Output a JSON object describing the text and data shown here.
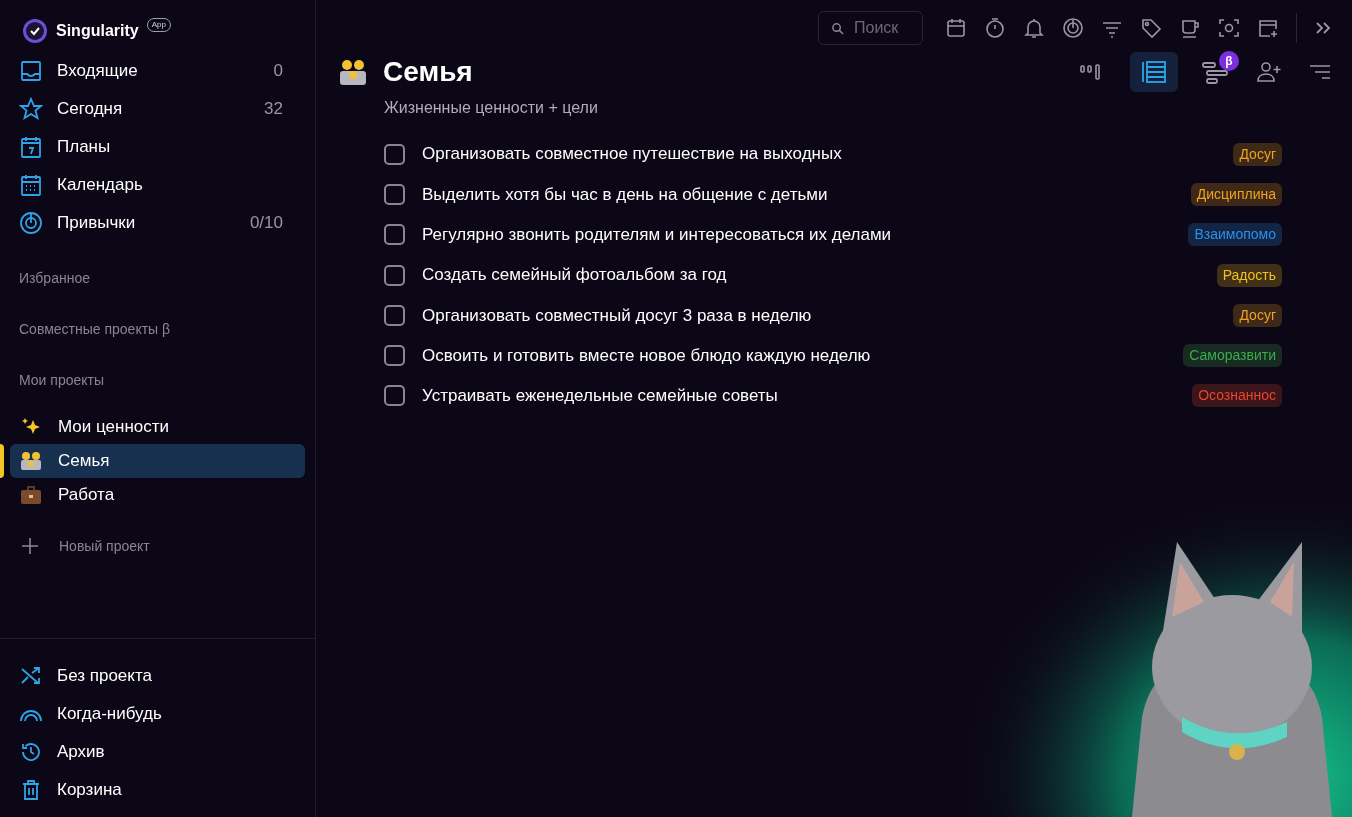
{
  "app": {
    "name": "Singularity",
    "badge": "App"
  },
  "nav": [
    {
      "label": "Входящие",
      "count": "0"
    },
    {
      "label": "Сегодня",
      "count": "32"
    },
    {
      "label": "Планы"
    },
    {
      "label": "Календарь"
    },
    {
      "label": "Привычки",
      "count": "0/10"
    }
  ],
  "sections": [
    "Избранное",
    "Совместные проекты β",
    "Мои проекты"
  ],
  "projects": [
    {
      "label": "Мои ценности",
      "selected": false
    },
    {
      "label": "Семья",
      "selected": true
    },
    {
      "label": "Работа",
      "selected": false
    }
  ],
  "new_project": "Новый проект",
  "bottom_nav": [
    "Без проекта",
    "Когда-нибудь",
    "Архив",
    "Корзина"
  ],
  "search": {
    "placeholder": "Поиск"
  },
  "view_toggles": [
    {
      "selected": false
    },
    {
      "selected": true
    },
    {
      "selected": false,
      "badge": "β"
    }
  ],
  "project": {
    "title": "Семья",
    "subtitle": "Жизненные ценности + цели"
  },
  "tasks": [
    {
      "text": "Организовать совместное путешествие на выходных",
      "checked": false,
      "tag": "Досуг",
      "color": "#3e2918"
    },
    {
      "text": "Выделить хотя бы час в день на общение с детьми",
      "checked": false,
      "tag": "Дисциплина",
      "color": "#3e2918"
    },
    {
      "text": "Регулярно звонить родителям и интересоваться их делами",
      "checked": false,
      "tag": "Взаимопомо",
      "color": "#132544"
    },
    {
      "text": "Создать семейный фотоальбом за год",
      "checked": false,
      "tag": "Радость",
      "color": "#3f3017"
    },
    {
      "text": "Организовать совместный досуг 3 раза в неделю",
      "checked": false,
      "tag": "Досуг",
      "color": "#3e2918"
    },
    {
      "text": "Освоить и готовить вместе новое блюдо каждую неделю",
      "checked": false,
      "tag": "Саморазвити",
      "color": "#172b22"
    },
    {
      "text": "Устраивать еженедельные семейные советы",
      "checked": false,
      "tag": "Осознаннос",
      "color": "#3c151b"
    }
  ],
  "sticker": {
    "kind": "picture"
  }
}
